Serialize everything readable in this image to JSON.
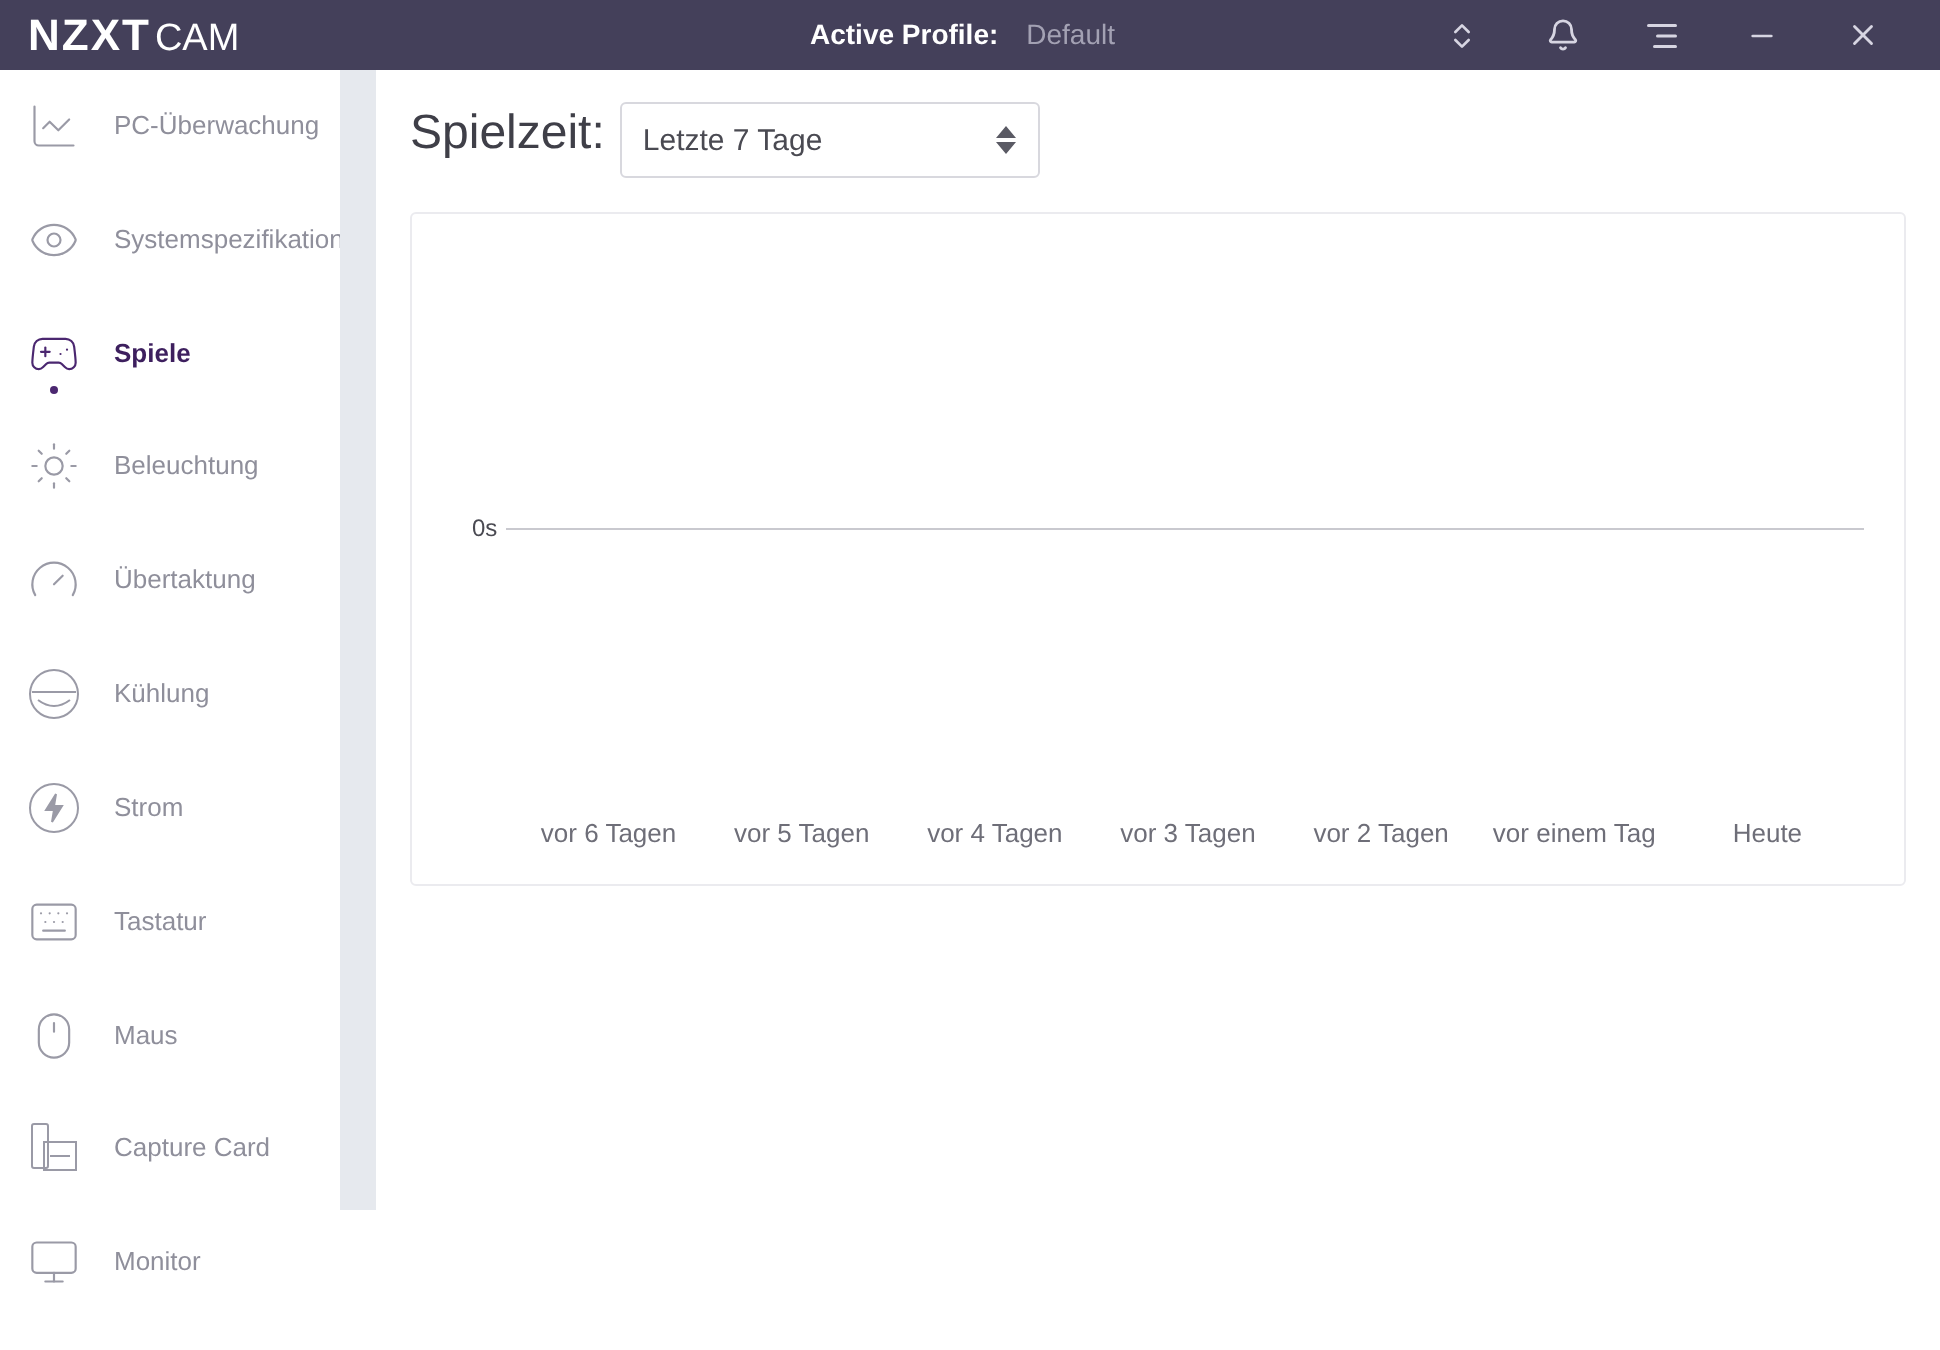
{
  "window": {
    "logo_bold": "NZXT",
    "logo_light": "CAM",
    "profile_label": "Active Profile:",
    "profile_value": "Default"
  },
  "sidebar": {
    "items": [
      {
        "label": "PC-Überwachung",
        "selected": false
      },
      {
        "label": "Systemspezifikation",
        "selected": false
      },
      {
        "label": "Spiele",
        "selected": true
      },
      {
        "label": "Beleuchtung",
        "selected": false
      },
      {
        "label": "Übertaktung",
        "selected": false
      },
      {
        "label": "Kühlung",
        "selected": false
      },
      {
        "label": "Strom",
        "selected": false
      },
      {
        "label": "Tastatur",
        "selected": false
      },
      {
        "label": "Maus",
        "selected": false
      },
      {
        "label": "Capture Card",
        "selected": false
      },
      {
        "label": "Monitor",
        "selected": false
      }
    ]
  },
  "playtime": {
    "label": "Spielzeit:",
    "period": "Letzte 7 Tage"
  },
  "chart": {
    "y_tick": "0s",
    "x_labels": [
      "vor 6 Tagen",
      "vor 5 Tagen",
      "vor 4 Tagen",
      "vor 3 Tagen",
      "vor 2 Tagen",
      "vor einem Tag",
      "Heute"
    ]
  }
}
